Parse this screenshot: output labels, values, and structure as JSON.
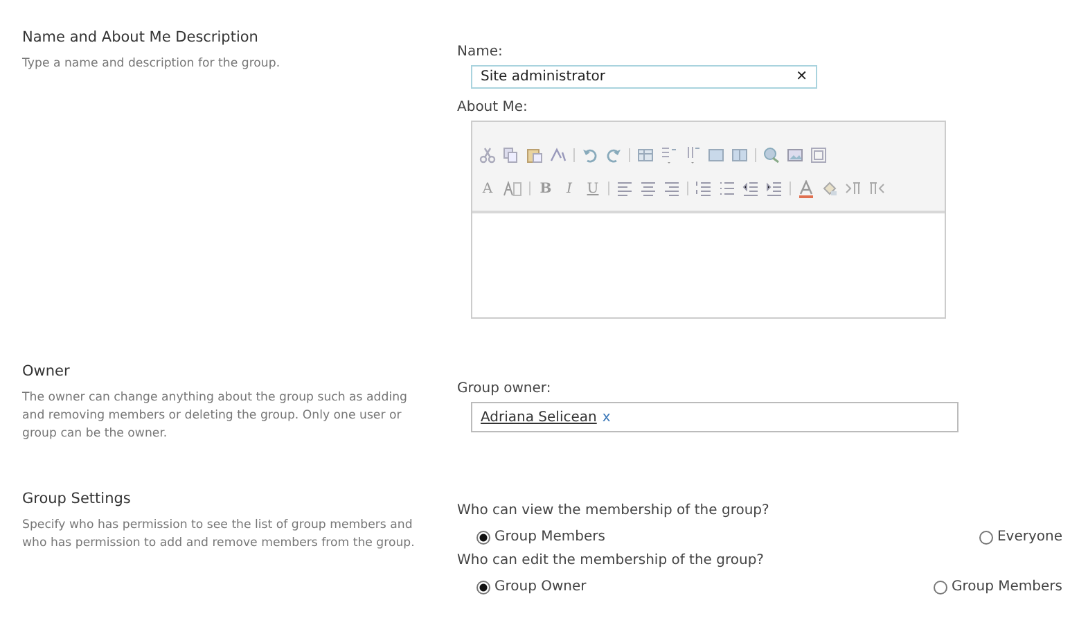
{
  "sections": [
    {
      "title": "Name and About Me Description",
      "description": "Type a name and description for the group.",
      "fields": [
        {
          "kind": "text",
          "label": "Name:",
          "value": "Site administrator",
          "clear": "✕"
        },
        {
          "kind": "rich",
          "label": "About Me:",
          "glyphs": [
            "A",
            "B",
            "I",
            "U"
          ]
        }
      ]
    },
    {
      "title": "Owner",
      "description": "The owner can change anything about the group such as adding and removing members or deleting the group. Only one user or group can be the owner.",
      "fields": [
        {
          "kind": "people",
          "label": "Group owner:",
          "person": "Adriana Selicean",
          "remove": "x"
        }
      ]
    },
    {
      "title": "Group Settings",
      "description": "Specify who has permission to see the list of group members and who has permission to add and remove members from the group.",
      "fields": [
        {
          "kind": "radio",
          "label": "Who can view the membership of the group?",
          "options": [
            {
              "label": "Group Members",
              "selected": true
            },
            {
              "label": "Everyone",
              "selected": false
            }
          ]
        },
        {
          "kind": "radio",
          "label": "Who can edit the membership of the group?",
          "options": [
            {
              "label": "Group Owner",
              "selected": true
            },
            {
              "label": "Group Members",
              "selected": false
            }
          ]
        }
      ]
    }
  ]
}
